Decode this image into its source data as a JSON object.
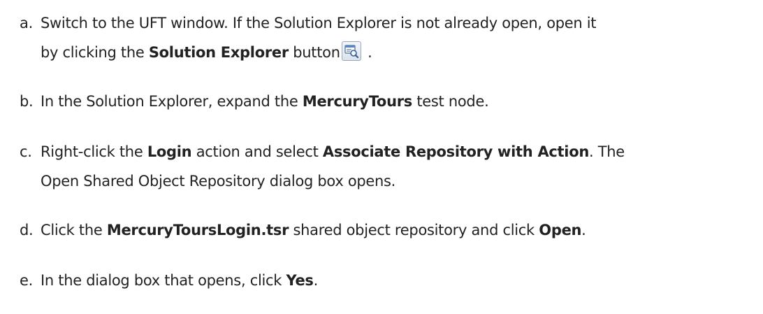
{
  "steps": [
    {
      "marker": "a.",
      "line1": {
        "t1": "Switch to the UFT window. If the Solution Explorer is not already open, open it"
      },
      "line2": {
        "t1": "by clicking the ",
        "b1": "Solution Explorer",
        "t2": " button",
        "t3": " ."
      },
      "icon": "solution-explorer-icon"
    },
    {
      "marker": "b.",
      "line1": {
        "t1": "In the Solution Explorer, expand the ",
        "b1": "MercuryTours",
        "t2": " test node."
      }
    },
    {
      "marker": "c.",
      "line1": {
        "t1": "Right-click the ",
        "b1": "Login",
        "t2": " action and select ",
        "b2": "Associate Repository with Action",
        "t3": ". The"
      },
      "line2": {
        "t1": "Open Shared Object Repository dialog box opens."
      }
    },
    {
      "marker": "d.",
      "line1": {
        "t1": "Click the ",
        "b1": "MercuryToursLogin.tsr",
        "t2": " shared object repository and click ",
        "b2": "Open",
        "t3": "."
      }
    },
    {
      "marker": "e.",
      "line1": {
        "t1": "In the dialog box that opens, click ",
        "b1": "Yes",
        "t2": "."
      }
    }
  ]
}
